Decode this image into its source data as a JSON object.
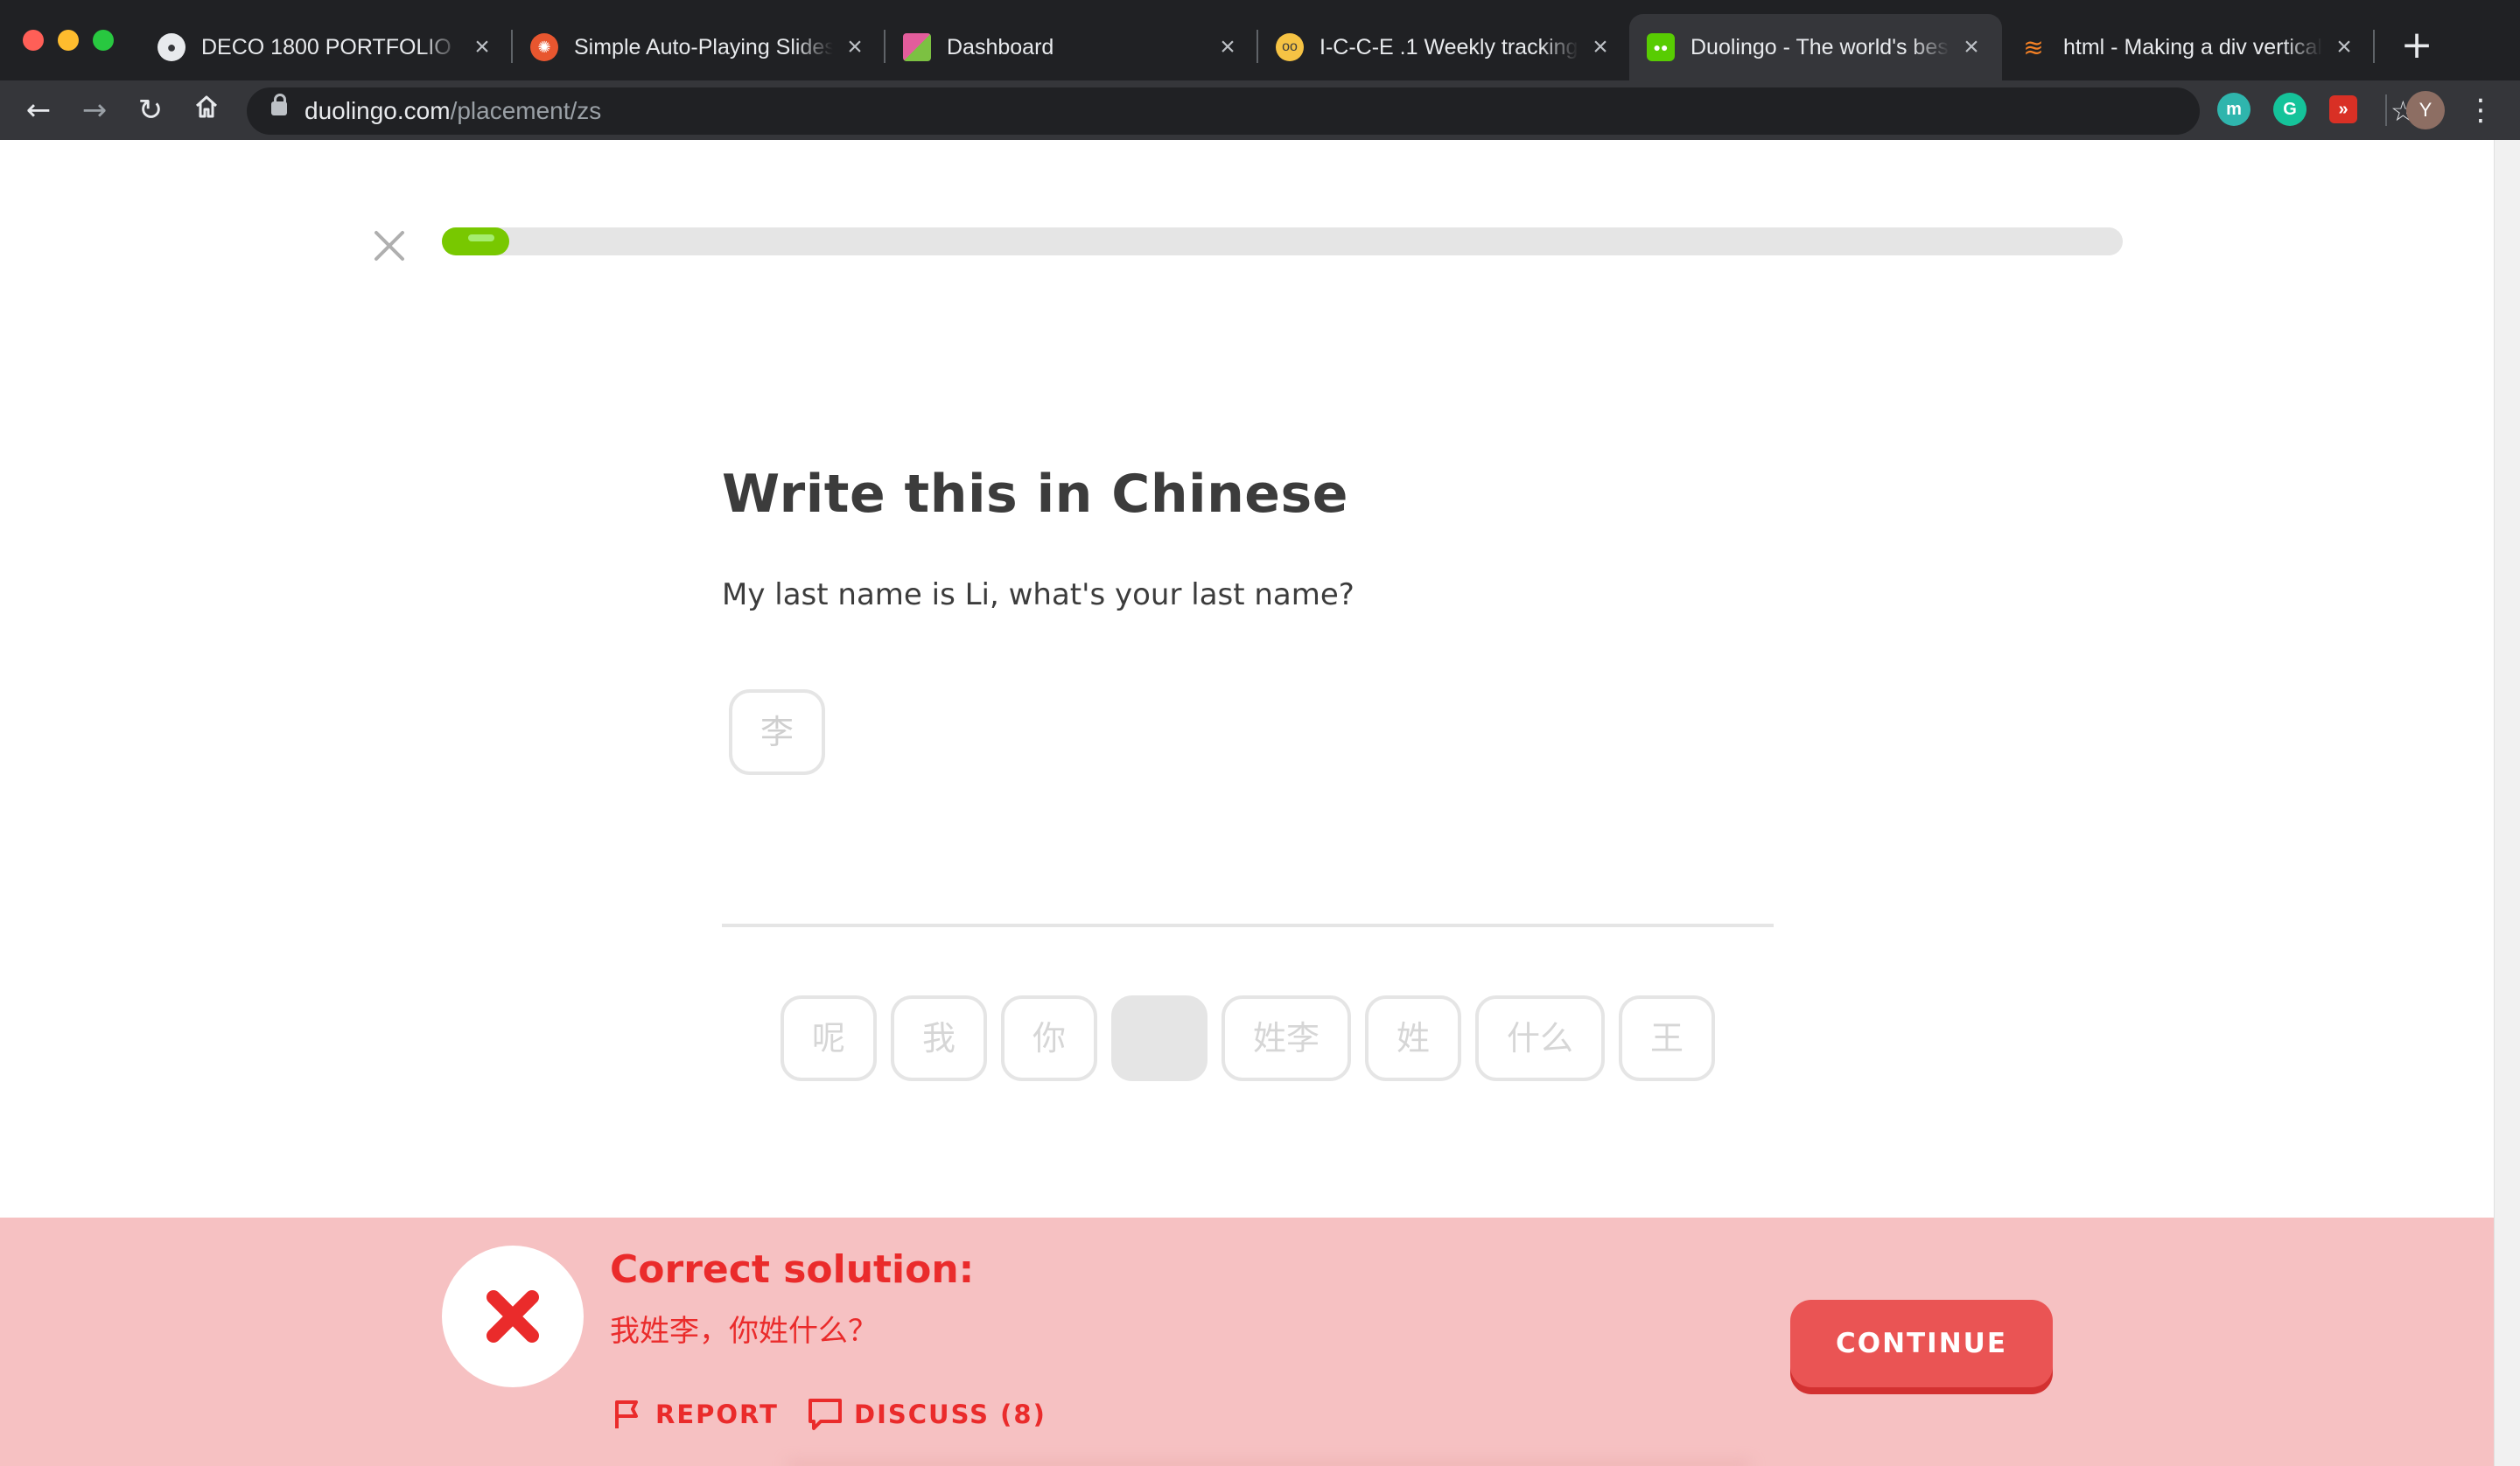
{
  "browser": {
    "tabs": [
      {
        "title": "DECO 1800 PORTFOLIO",
        "icon": "elephant-icon"
      },
      {
        "title": "Simple Auto-Playing Slideshow",
        "icon": "codepen-icon"
      },
      {
        "title": "Dashboard",
        "icon": "dashboard-icon"
      },
      {
        "title": "I-C-C-E .1 Weekly tracking",
        "icon": "glasses-emoji-icon"
      },
      {
        "title": "Duolingo - The world's best way to learn a language",
        "icon": "duolingo-owl-icon",
        "active": true
      },
      {
        "title": "html - Making a div vertically scrollable",
        "icon": "stack-overflow-icon"
      }
    ],
    "url_host": "duolingo.com",
    "url_path": "/placement/zs",
    "profile_initial": "Y",
    "extensions": [
      "m",
      "G",
      "»"
    ]
  },
  "lesson": {
    "progress": 0.04,
    "title": "Write this in Chinese",
    "prompt": "My last name is Li, what's your last name?",
    "answer_tiles": [
      "李"
    ],
    "word_bank": [
      "呢",
      "我",
      "你",
      "",
      "姓李",
      "姓",
      "什么",
      "王"
    ]
  },
  "feedback": {
    "title": "Correct solution:",
    "solution": "我姓李，你姓什么？",
    "report_label": "REPORT",
    "discuss_label": "DISCUSS (8)",
    "continue_label": "CONTINUE"
  },
  "colors": {
    "progress_fill": "#78c800",
    "error_red": "#ea2b2b",
    "footer_bg": "#f6c1c2",
    "continue_bg": "#ea5454"
  }
}
